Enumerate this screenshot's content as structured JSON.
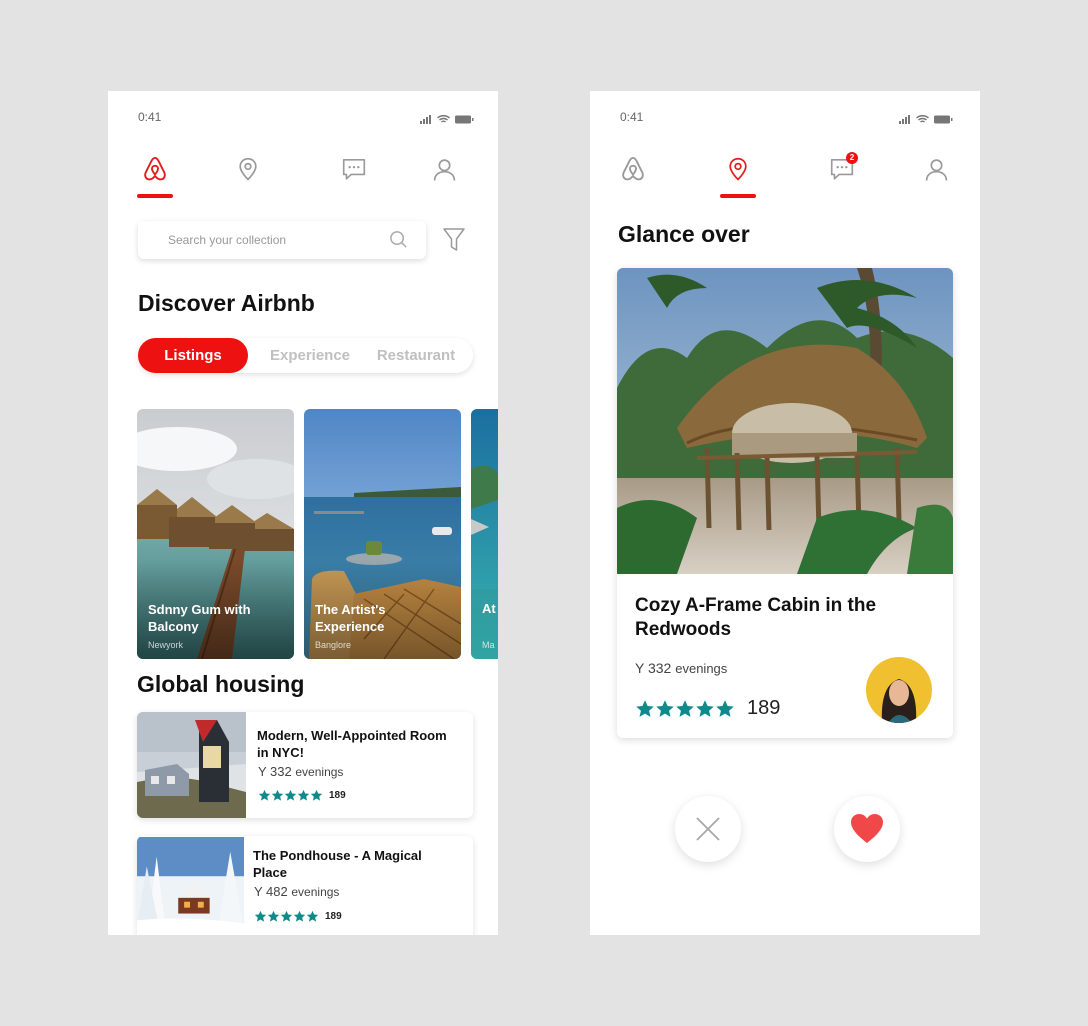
{
  "colors": {
    "accent": "#e11d1d",
    "teal": "#0f8a8a",
    "inactive_icon": "#9a9a9a",
    "background": "#e3e3e3"
  },
  "left_screen": {
    "status_time": "0:41",
    "nav": [
      {
        "icon": "airbnb-logo-icon",
        "active": true
      },
      {
        "icon": "location-pin-icon",
        "active": false
      },
      {
        "icon": "chat-icon",
        "active": false
      },
      {
        "icon": "user-icon",
        "active": false
      }
    ],
    "search": {
      "placeholder": "Search your collection"
    },
    "discover_title": "Discover Airbnb",
    "tabs": [
      "Listings",
      "Experience",
      "Restaurant"
    ],
    "active_tab": "Listings",
    "cards": [
      {
        "title": "Sdnny Gum with Balcony",
        "location": "Newyork"
      },
      {
        "title": "The Artist's Experience",
        "location": "Banglore"
      },
      {
        "title": "At",
        "location": "Ma"
      }
    ],
    "global_title": "Global housing",
    "listings": [
      {
        "title": "Modern, Well-Appointed Room in NYC!",
        "price": "Y 332",
        "unit": "evenings",
        "rating_stars": 5,
        "reviews": "189"
      },
      {
        "title": "The Pondhouse - A Magical Place",
        "price": "Y 482",
        "unit": "evenings",
        "rating_stars": 5,
        "reviews": "189"
      }
    ]
  },
  "right_screen": {
    "status_time": "0:41",
    "nav": [
      {
        "icon": "airbnb-logo-icon",
        "active": false
      },
      {
        "icon": "location-pin-icon",
        "active": true
      },
      {
        "icon": "chat-icon",
        "active": false,
        "badge": "2"
      },
      {
        "icon": "user-icon",
        "active": false
      }
    ],
    "glance_title": "Glance over",
    "featured": {
      "title": "Cozy A-Frame Cabin in the Redwoods",
      "price": "Y 332",
      "unit": "evenings",
      "rating_stars": 5,
      "reviews": "189"
    },
    "actions": {
      "dismiss_icon": "close-icon",
      "like_icon": "heart-icon"
    }
  }
}
